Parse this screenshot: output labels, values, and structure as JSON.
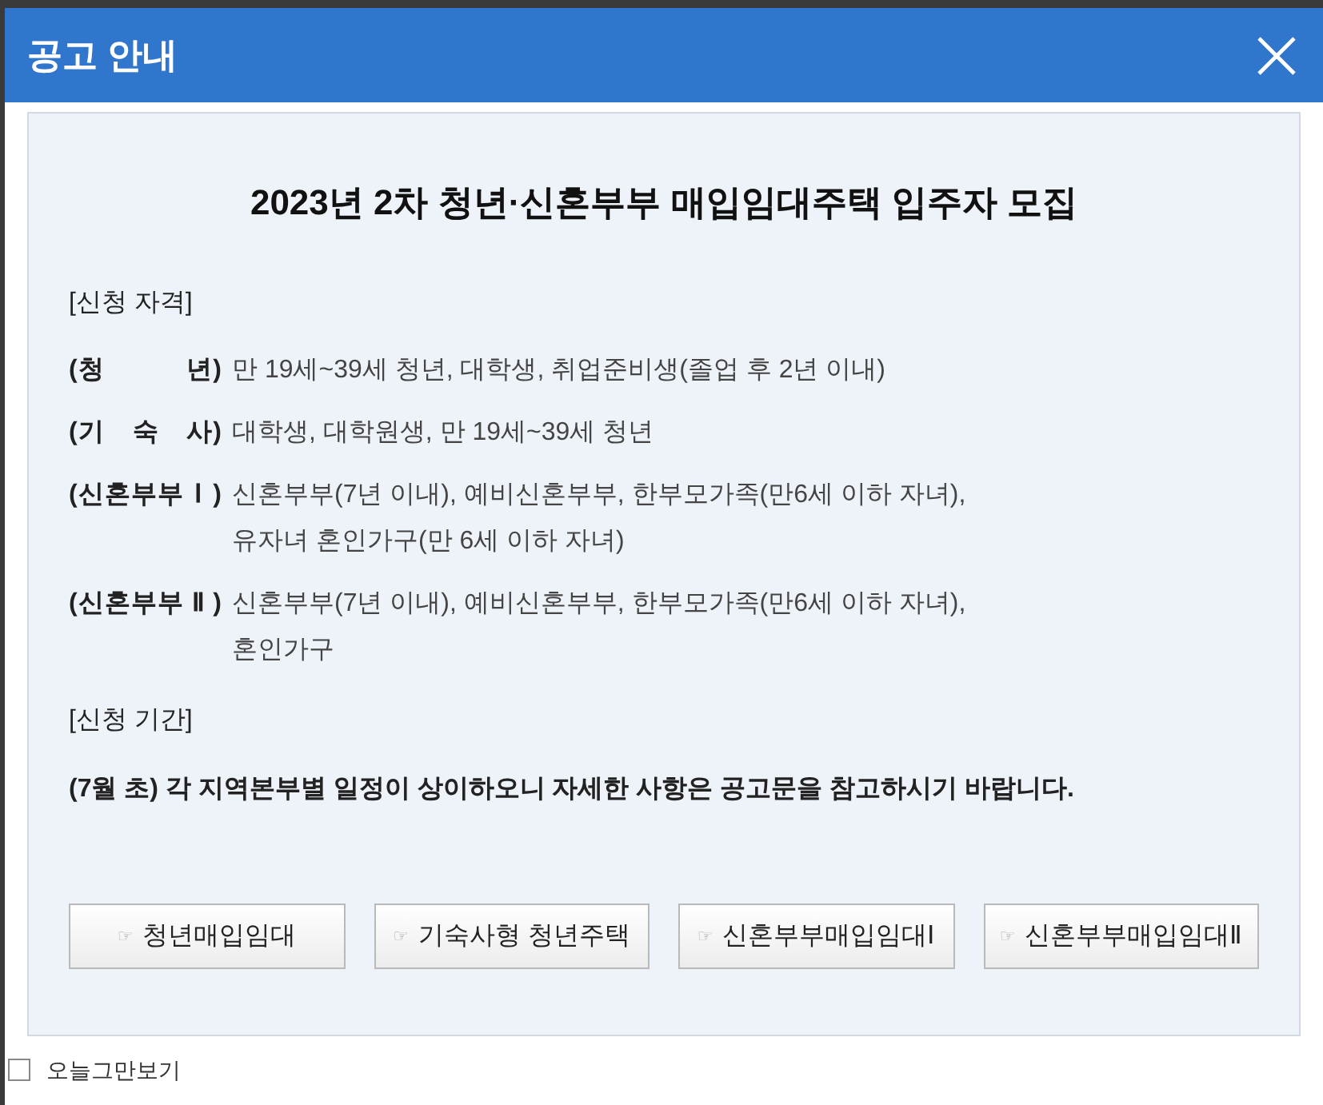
{
  "window": {
    "title": "공고 안내"
  },
  "notice": {
    "title": "2023년 2차 청년·신혼부부 매입임대주택 입주자 모집",
    "sections": [
      {
        "kind": "list",
        "heading": "[신청 자격]",
        "items": [
          {
            "label": "(청 년)",
            "lines": [
              "만 19세~39세 청년, 대학생, 취업준비생(졸업 후 2년 이내)"
            ]
          },
          {
            "label": "(기 숙 사)",
            "lines": [
              "대학생, 대학원생, 만 19세~39세 청년"
            ]
          },
          {
            "label": "(신혼부부Ⅰ)",
            "lines": [
              "신혼부부(7년 이내), 예비신혼부부, 한부모가족(만6세 이하 자녀),",
              "유자녀 혼인가구(만 6세 이하 자녀)"
            ]
          },
          {
            "label": "(신혼부부Ⅱ)",
            "lines": [
              "신혼부부(7년 이내), 예비신혼부부, 한부모가족(만6세 이하 자녀),",
              "혼인가구"
            ]
          }
        ]
      },
      {
        "kind": "paragraph",
        "heading": "[신청 기간]",
        "text": "(7월 초) 각 지역본부별 일정이 상이하오니 자세한 사항은 공고문을 참고하시기 바랍니다."
      }
    ]
  },
  "buttons": [
    {
      "icon": "☞",
      "label": "청년매입임대"
    },
    {
      "icon": "☞",
      "label": "기숙사형 청년주택"
    },
    {
      "icon": "☞",
      "label": "신혼부부매입임대Ⅰ"
    },
    {
      "icon": "☞",
      "label": "신혼부부매입임대Ⅱ"
    }
  ],
  "footer": {
    "checkbox": {
      "label": "오늘그만보기",
      "checked": false
    }
  }
}
